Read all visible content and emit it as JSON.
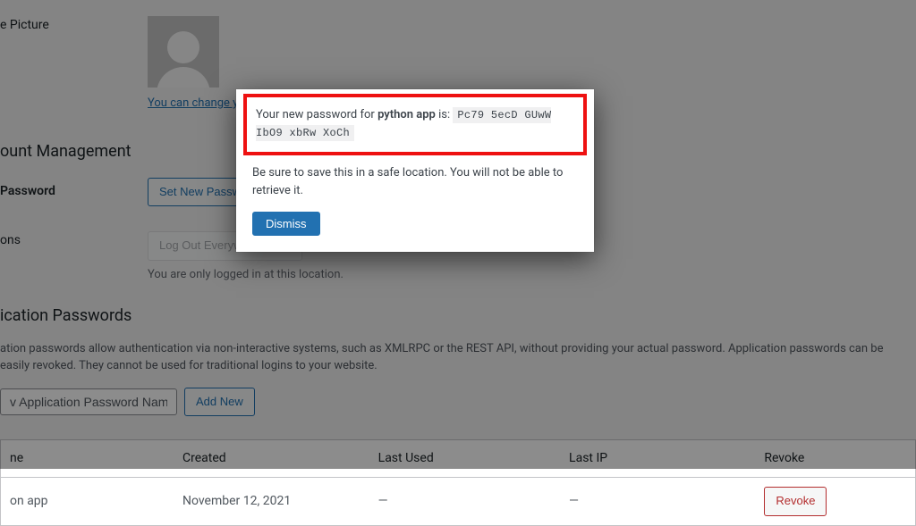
{
  "profile": {
    "picture_label": "e Picture",
    "gravatar_link": "You can change your"
  },
  "account": {
    "heading": "ount Management",
    "password_label": "Password",
    "set_password_btn": "Set New Password",
    "sessions_label": "ons",
    "logout_btn": "Log Out Everywhere Else",
    "logout_helper": "You are only logged in at this location."
  },
  "app_passwords": {
    "heading": "ication Passwords",
    "description": "ation passwords allow authentication via non-interactive systems, such as XMLRPC or the REST API, without providing your actual password. Application passwords can be easily revoked. They cannot be used for traditional logins to your website.",
    "name_placeholder": "v Application Password Name",
    "add_btn": "Add New",
    "table": {
      "headers": {
        "name": "ne",
        "created": "Created",
        "last_used": "Last Used",
        "last_ip": "Last IP",
        "revoke": "Revoke"
      },
      "rows": [
        {
          "name": "on app",
          "created": "November 12, 2021",
          "last_used": "—",
          "last_ip": "—",
          "revoke": "Revoke"
        }
      ]
    }
  },
  "modal": {
    "prefix": "Your new password for ",
    "app_name": "python app",
    "suffix": " is: ",
    "password": "Pc79 5ecD GUwW IbO9 xbRw XoCh",
    "warning": "Be sure to save this in a safe location. You will not be able to retrieve it.",
    "dismiss": "Dismiss"
  }
}
